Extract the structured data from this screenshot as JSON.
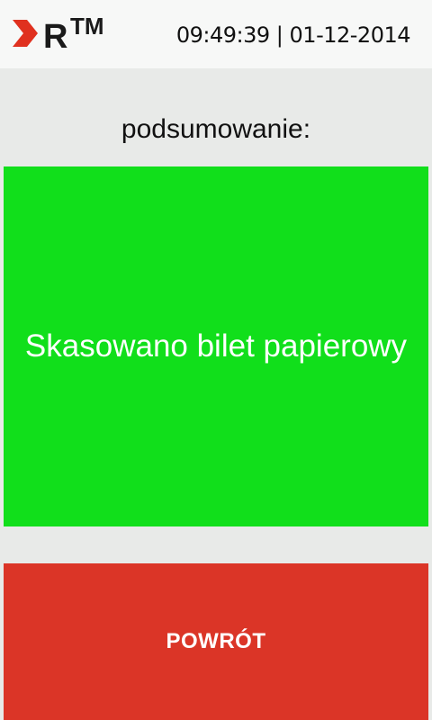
{
  "header": {
    "logo_icon": "rtm-logo",
    "logo_text": "RTM",
    "datetime": "09:49:39 | 01-12-2014"
  },
  "summary": {
    "label": "podsumowanie:",
    "message": "Skasowano bilet papierowy",
    "status_color": "#11df1b"
  },
  "actions": {
    "back_label": "POWRÓT",
    "back_color": "#db3527"
  }
}
